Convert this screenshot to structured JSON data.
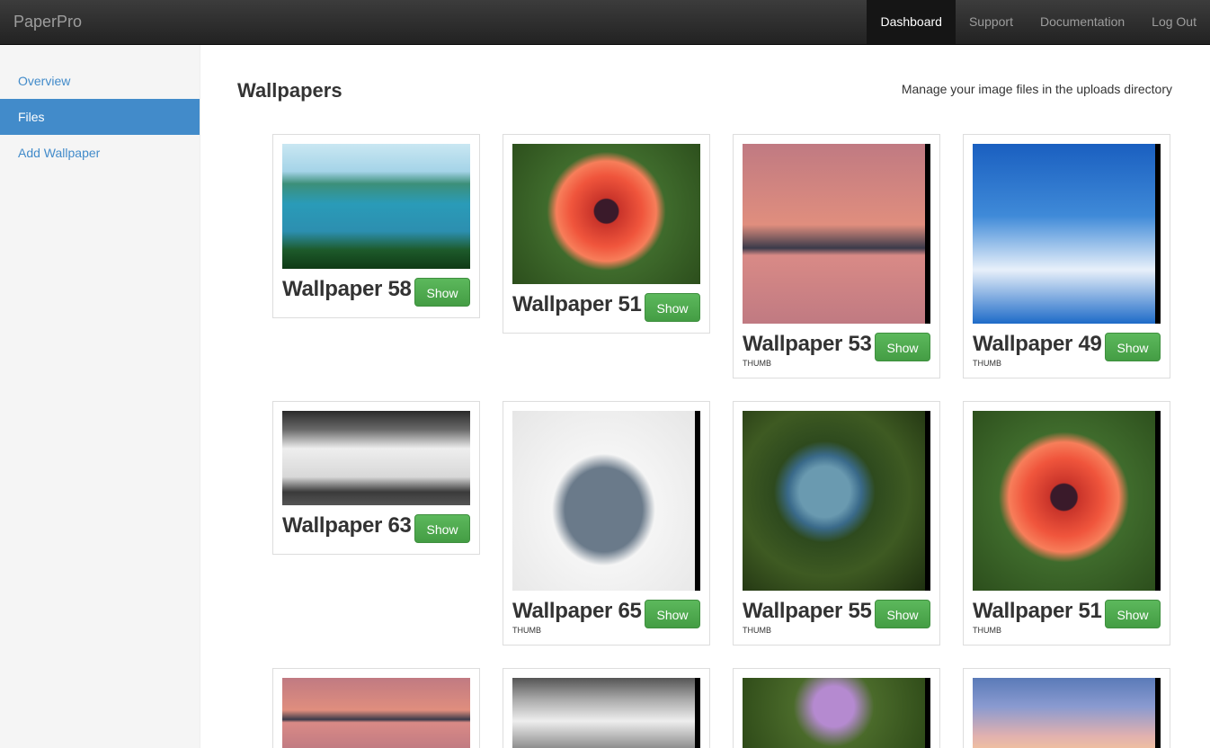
{
  "app": {
    "brand": "PaperPro"
  },
  "navbar": {
    "links": [
      {
        "label": "Dashboard",
        "active": true
      },
      {
        "label": "Support"
      },
      {
        "label": "Documentation"
      },
      {
        "label": "Log Out"
      }
    ]
  },
  "sidebar": {
    "items": [
      {
        "label": "Overview"
      },
      {
        "label": "Files",
        "active": true
      },
      {
        "label": "Add Wallpaper"
      }
    ]
  },
  "main": {
    "title": "Wallpapers",
    "subtitle": "Manage your image files in the uploads directory",
    "show_label": "Show",
    "thumb_label": "THUMB",
    "cards": [
      {
        "title": "Wallpaper 58",
        "image": "halong-bay-image",
        "thumb": false
      },
      {
        "title": "Wallpaper 51",
        "image": "poppy-image",
        "thumb": false
      },
      {
        "title": "Wallpaper 53",
        "image": "tower-bridge-image",
        "thumb": true
      },
      {
        "title": "Wallpaper 49",
        "image": "daisy-sky-image",
        "thumb": true
      },
      {
        "title": "Wallpaper 63",
        "image": "bmw-car-image",
        "thumb": false
      },
      {
        "title": "Wallpaper 65",
        "image": "volvo-car-image",
        "thumb": true
      },
      {
        "title": "Wallpaper 55",
        "image": "bubble-image",
        "thumb": true
      },
      {
        "title": "Wallpaper 51",
        "image": "poppy-image",
        "thumb": true
      },
      {
        "title": "",
        "image": "tower-bridge-image"
      },
      {
        "title": "",
        "image": "car-image"
      },
      {
        "title": "",
        "image": "purple-flower-image"
      },
      {
        "title": "",
        "image": "sunset-sky-image"
      }
    ]
  }
}
